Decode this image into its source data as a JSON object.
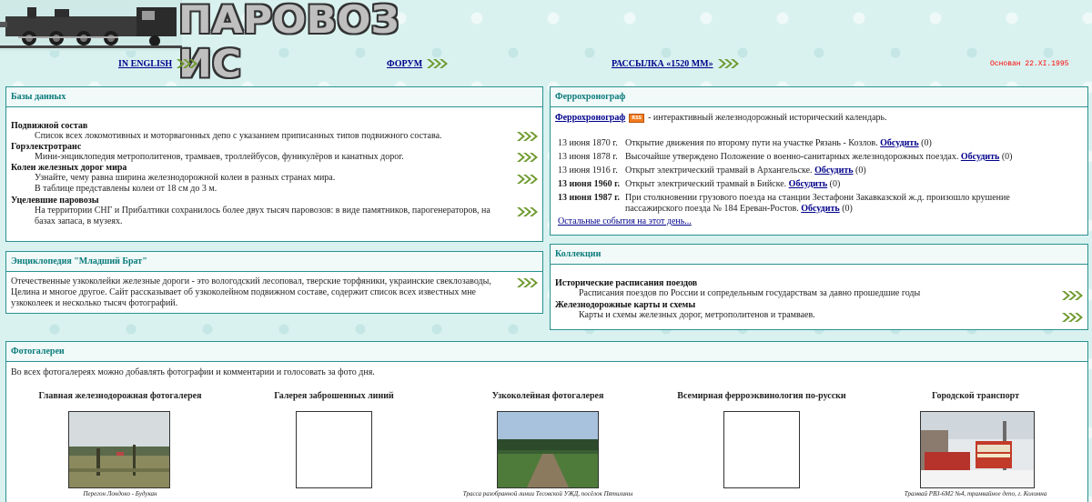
{
  "header": {
    "logo_text": "ПАРОВОЗ ИС",
    "links": [
      {
        "label": "IN ENGLISH"
      },
      {
        "label": "ФОРУМ"
      },
      {
        "label": "РАССЫЛКА «1520 ММ»"
      }
    ],
    "founded": "Основан 22.XI.1995"
  },
  "databases": {
    "title": "Базы данных",
    "items": [
      {
        "title": "Подвижной состав",
        "desc": [
          "Список всех локомотивных и моторвагонных депо с указанием приписанных типов подвижного состава."
        ]
      },
      {
        "title": "Горэлектротранс",
        "desc": [
          "Мини-энциклопедия метрополитенов, трамваев, троллейбусов, фуникулёров и канатных дорог."
        ]
      },
      {
        "title": "Колеи железных дорог мира",
        "desc": [
          "Узнайте, чему равна ширина железнодорожной колеи в разных странах мира.",
          "В таблице представлены колеи от 18 см до 3 м."
        ]
      },
      {
        "title": "Уцелевшие паровозы",
        "desc": [
          "На территории СНГ и Прибалтики сохранилось более двух тысяч паровозов: в виде памятников, парогенераторов, на",
          "базах запаса, в музеях."
        ]
      }
    ]
  },
  "encyclopedia": {
    "title": "Энциклопедия \"Младший Брат\"",
    "text": [
      "Отечественные узкоколейки железные дороги - это вологодский лесоповал, тверские торфяники, украинские свеклозаводы,",
      "Целина и многое другое. Сайт рассказывает об узкоколейном подвижном составе, содержит список всех известных мне",
      "узкоколеек и несколько тысяч фотографий."
    ]
  },
  "chronograph": {
    "title": "Феррохронограф",
    "link": "Феррохронограф",
    "rss": "RSS",
    "intro": " - интерактивный железнодорожный исторический календарь.",
    "events": [
      {
        "date": "13 июня 1870 г.",
        "bold": false,
        "text": [
          "Открытие движения по второму пути на участке Рязань - Козлов."
        ],
        "discuss": "Обсудить",
        "count": "(0)"
      },
      {
        "date": "13 июня 1878 г.",
        "bold": false,
        "text": [
          "Высочайше утверждено Положение о военно-санитарных железнодорожных поездах."
        ],
        "discuss": "Обсудить",
        "count": "(0)"
      },
      {
        "date": "13 июня 1916 г.",
        "bold": false,
        "text": [
          "Открыт электрический трамвай в Архангельске."
        ],
        "discuss": "Обсудить",
        "count": "(0)"
      },
      {
        "date": "13 июня 1960 г.",
        "bold": true,
        "text": [
          "Открыт электрический трамвай в Бийске."
        ],
        "discuss": "Обсудить",
        "count": "(0)"
      },
      {
        "date": "13 июня 1987 г.",
        "bold": true,
        "text": [
          "При столкновении грузового поезда на станции Зестафони Закавказской ж.д. произошло крушение",
          "пассажирского поезда № 184 Ереван-Ростов."
        ],
        "discuss": "Обсудить",
        "count": "(0)"
      }
    ],
    "more": "Остальные события на этот день..."
  },
  "collections": {
    "title": "Коллекции",
    "items": [
      {
        "title": "Исторические расписания поездов",
        "desc": "Расписания поездов по России и сопредельным государствам за давно прошедшие годы"
      },
      {
        "title": "Железнодорожные карты и схемы",
        "desc": "Карты и схемы железных дорог, метрополитенов и трамваев."
      }
    ]
  },
  "galleries": {
    "title": "Фотогалереи",
    "intro": "Во всех фотогалереях можно добавлять фотографии и комментарии и голосовать за фото дня.",
    "items": [
      {
        "title": "Главная железнодорожная фотогалерея",
        "caption": "Перегон Лондоко - Будукан",
        "photo": "rail-landscape"
      },
      {
        "title": "Галерея заброшенных линий",
        "caption": "",
        "photo": "empty"
      },
      {
        "title": "Узкоколейная фотогалерея",
        "caption": "Трасса разобранной линии Тесовской УЖД, посёлок Пятилины",
        "photo": "forest-track"
      },
      {
        "title": "Всемирная ферроэквинология по-русски",
        "caption": "",
        "photo": "empty"
      },
      {
        "title": "Городской транспорт",
        "caption": "Трамвай РВЗ-6М2 №4, трамвайное депо, г. Коломна",
        "photo": "tram-depot"
      }
    ]
  },
  "colors": {
    "panel_border": "#2a9191",
    "panel_title": "#0a7b7b",
    "link": "#00008b",
    "founded": "#ff0000",
    "chevron": "#6e9a2e"
  }
}
